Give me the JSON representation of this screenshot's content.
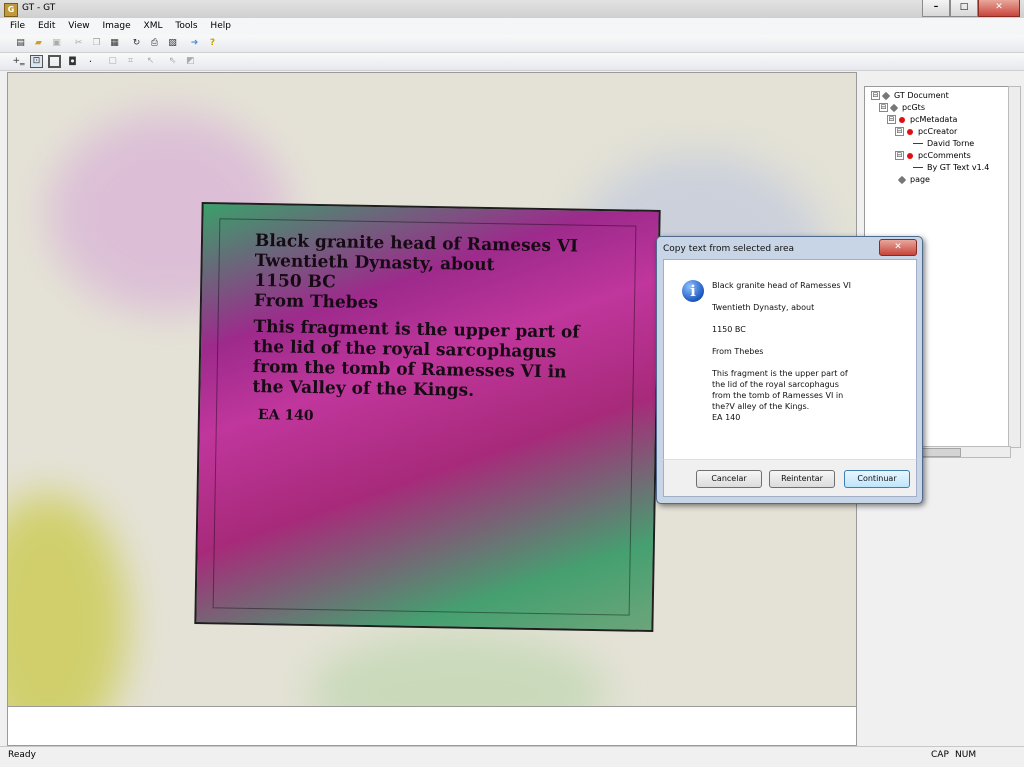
{
  "window": {
    "title": "GT - GT",
    "app_icon": "G",
    "controls": {
      "minimize": "–",
      "maximize": "□",
      "close": "✕"
    }
  },
  "menu": [
    "File",
    "Edit",
    "View",
    "Image",
    "XML",
    "Tools",
    "Help"
  ],
  "toolbar_icons": {
    "row1": [
      "new-icon",
      "open-icon",
      "save-icon",
      "cut-icon",
      "copy-icon",
      "paste-icon",
      "refresh-icon",
      "print-icon",
      "print-preview-icon",
      "arrow-icon",
      "help-icon"
    ],
    "row2": [
      "zoom-fit-icon",
      "select-region-icon",
      "rect-thick-icon",
      "rect-icon",
      "dot-icon",
      "page-icon",
      "crop-icon",
      "pointer-icon",
      "pointer-arrow-icon",
      "tag-icon"
    ]
  },
  "image": {
    "lines_a": [
      "Black granite head of Rameses VI",
      "Twentieth Dynasty, about",
      "1150 BC",
      "From Thebes"
    ],
    "lines_b": [
      "This fragment is the upper part of",
      "the lid of the royal sarcophagus",
      "from the tomb of Ramesses VI in",
      "the Valley of the Kings."
    ],
    "ea": "EA 140"
  },
  "tree": [
    {
      "label": "GT Document",
      "marker": "grey",
      "toggle": "⊟"
    },
    {
      "label": "pcGts",
      "marker": "grey",
      "toggle": "⊟"
    },
    {
      "label": "pcMetadata",
      "marker": "red",
      "toggle": "⊟"
    },
    {
      "label": "pcCreator",
      "marker": "red",
      "toggle": "⊟"
    },
    {
      "label": "David Torne",
      "marker": "dash",
      "toggle": ""
    },
    {
      "label": "pcComments",
      "marker": "red",
      "toggle": "⊟"
    },
    {
      "label": "By GT Text v1.4",
      "marker": "dash",
      "toggle": ""
    },
    {
      "label": "page",
      "marker": "grey",
      "toggle": ""
    }
  ],
  "dialog": {
    "title": "Copy text from selected area",
    "close": "✕",
    "icon": "info-icon",
    "line1": "Black granite head of Ramesses VI",
    "line2": "Twentieth Dynasty, about",
    "line3": "1150 BC",
    "line4": "From Thebes",
    "para": [
      "This fragment is the upper part of",
      "the lid of the royal sarcophagus",
      "from the tomb of Ramesses VI in",
      "the?V alley of the Kings.",
      "EA 140"
    ],
    "buttons": {
      "cancel": "Cancelar",
      "retry": "Reintentar",
      "continue": "Continuar"
    }
  },
  "status": {
    "text": "Ready",
    "cap": "CAP",
    "num": "NUM"
  }
}
